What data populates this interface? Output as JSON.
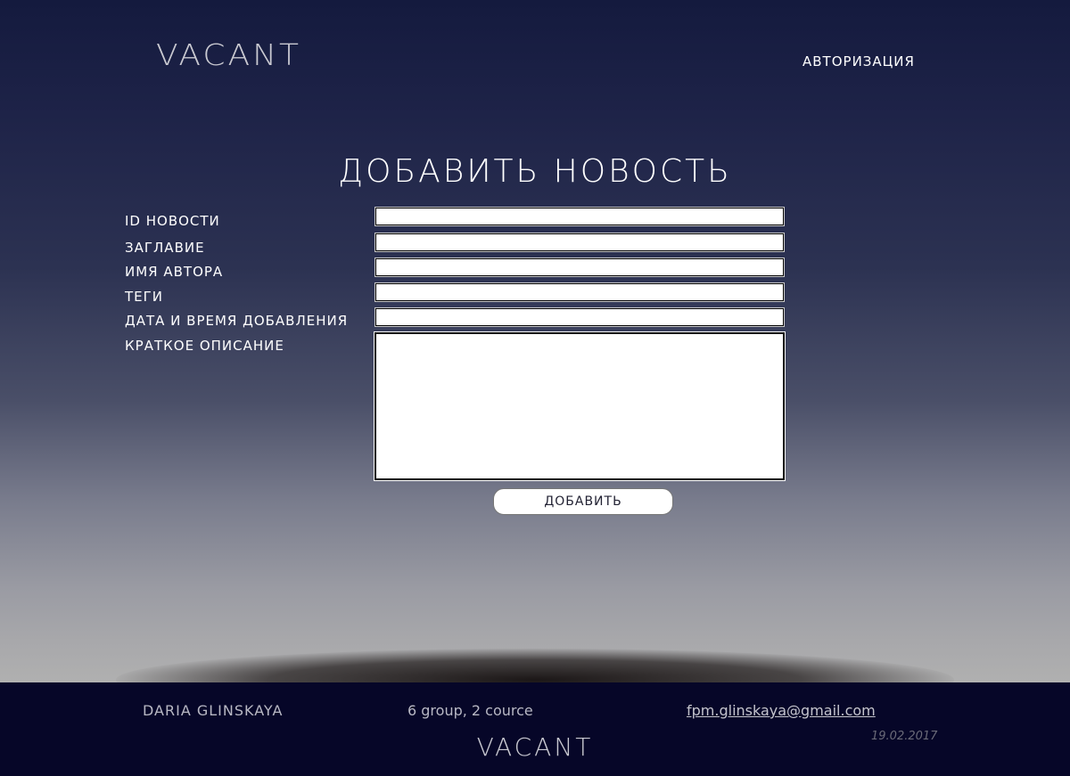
{
  "header": {
    "logo": "VACANT",
    "auth_link": "АВТОРИЗАЦИЯ"
  },
  "page": {
    "title": "ДОБАВИТЬ НОВОСТЬ"
  },
  "form": {
    "fields": [
      {
        "label": "ID НОВОСТИ",
        "value": ""
      },
      {
        "label": "ЗАГЛАВИЕ",
        "value": ""
      },
      {
        "label": "ИМЯ АВТОРА",
        "value": ""
      },
      {
        "label": "ТЕГИ",
        "value": ""
      },
      {
        "label": "ДАТА И ВРЕМЯ ДОБАВЛЕНИЯ",
        "value": ""
      },
      {
        "label": "КРАТКОЕ ОПИСАНИЕ",
        "value": ""
      }
    ],
    "submit_label": "ДОБАВИТЬ"
  },
  "footer": {
    "name": "DARIA GLINSKAYA",
    "group": "6 group, 2 cource",
    "email": "fpm.glinskaya@gmail.com",
    "date": "19.02.2017",
    "logo": "VACANT"
  },
  "colors": {
    "background_top": "#141a3e",
    "background_bottom": "#b0b0b0",
    "footer_bg": "#060628",
    "text_light": "#ffffff"
  }
}
